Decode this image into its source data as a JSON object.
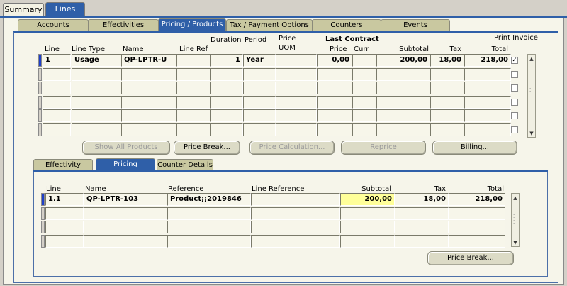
{
  "top_tabs": [
    {
      "label": "Summary",
      "active": false
    },
    {
      "label": "Lines",
      "active": true
    }
  ],
  "sub_tabs": [
    {
      "label": "Accounts"
    },
    {
      "label": "Effectivities"
    },
    {
      "label": "Pricing / Products"
    },
    {
      "label": "Tax / Payment Options"
    },
    {
      "label": "Counters"
    },
    {
      "label": "Events"
    }
  ],
  "lines_table": {
    "headers": {
      "line": "Line",
      "line_type": "Line Type",
      "name": "Name",
      "line_ref": "Line Ref",
      "duration": "Duration",
      "period": "Period",
      "price_uom_1": "Price",
      "price_uom_2": "UOM",
      "last_contract": "Last Contract",
      "price": "Price",
      "curr": "Curr",
      "subtotal": "Subtotal",
      "tax": "Tax",
      "total": "Total",
      "print_invoice": "Print Invoice"
    },
    "rows": [
      {
        "line": "1",
        "line_type": "Usage",
        "name": "QP-LPTR-U",
        "line_ref": "",
        "duration": "1",
        "period": "Year",
        "price_uom": "",
        "price": "0,00",
        "curr": "",
        "subtotal": "200,00",
        "tax": "18,00",
        "total": "218,00",
        "print_invoice": "✓"
      },
      {
        "line": "",
        "line_type": "",
        "name": "",
        "line_ref": "",
        "duration": "",
        "period": "",
        "price_uom": "",
        "price": "",
        "curr": "",
        "subtotal": "",
        "tax": "",
        "total": "",
        "print_invoice": ""
      },
      {
        "line": "",
        "line_type": "",
        "name": "",
        "line_ref": "",
        "duration": "",
        "period": "",
        "price_uom": "",
        "price": "",
        "curr": "",
        "subtotal": "",
        "tax": "",
        "total": "",
        "print_invoice": ""
      },
      {
        "line": "",
        "line_type": "",
        "name": "",
        "line_ref": "",
        "duration": "",
        "period": "",
        "price_uom": "",
        "price": "",
        "curr": "",
        "subtotal": "",
        "tax": "",
        "total": "",
        "print_invoice": ""
      },
      {
        "line": "",
        "line_type": "",
        "name": "",
        "line_ref": "",
        "duration": "",
        "period": "",
        "price_uom": "",
        "price": "",
        "curr": "",
        "subtotal": "",
        "tax": "",
        "total": "",
        "print_invoice": ""
      },
      {
        "line": "",
        "line_type": "",
        "name": "",
        "line_ref": "",
        "duration": "",
        "period": "",
        "price_uom": "",
        "price": "",
        "curr": "",
        "subtotal": "",
        "tax": "",
        "total": "",
        "print_invoice": ""
      }
    ]
  },
  "buttons": {
    "show_all_products": "Show All Products",
    "price_break": "Price Break...",
    "price_calculation": "Price Calculation...",
    "reprice": "Reprice",
    "billing": "Billing...",
    "price_break_bottom": "Price Break..."
  },
  "lower_tabs": [
    {
      "label": "Effectivity"
    },
    {
      "label": "Pricing"
    },
    {
      "label": "Counter Details"
    }
  ],
  "pricing_table": {
    "headers": {
      "line": "Line",
      "name": "Name",
      "reference": "Reference",
      "line_reference": "Line Reference",
      "subtotal": "Subtotal",
      "tax": "Tax",
      "total": "Total"
    },
    "rows": [
      {
        "line": "1.1",
        "name": "QP-LPTR-103",
        "reference": "Product;;2019846",
        "line_reference": "",
        "subtotal": "200,00",
        "tax": "18,00",
        "total": "218,00"
      },
      {
        "line": "",
        "name": "",
        "reference": "",
        "line_reference": "",
        "subtotal": "",
        "tax": "",
        "total": ""
      },
      {
        "line": "",
        "name": "",
        "reference": "",
        "line_reference": "",
        "subtotal": "",
        "tax": "",
        "total": ""
      },
      {
        "line": "",
        "name": "",
        "reference": "",
        "line_reference": "",
        "subtotal": "",
        "tax": "",
        "total": ""
      }
    ]
  },
  "colors": {
    "accent": "#2f5fa8",
    "highlight": "#ffff99",
    "background": "#f6f5ea"
  }
}
